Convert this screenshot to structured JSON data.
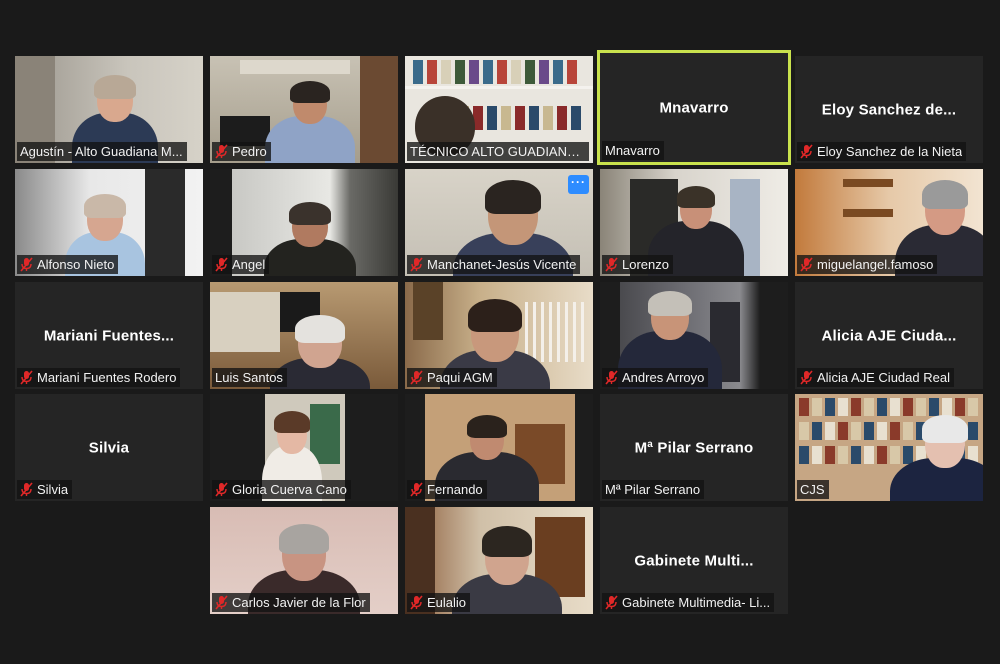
{
  "app": "Zoom gallery view",
  "colors": {
    "background": "#1a1a1a",
    "tile": "#252525",
    "active_speaker_border": "#c9e24d",
    "muted_icon": "#e02828",
    "more_button": "#2d8cff"
  },
  "participants": [
    {
      "name": "Agustín - Alto Guadiana M...",
      "muted": false,
      "video": true,
      "scene": "office-bright"
    },
    {
      "name": "Pedro",
      "muted": true,
      "video": true,
      "scene": "office-shelf"
    },
    {
      "name": "TÉCNICO ALTO GUADIANA ...",
      "muted": false,
      "video": true,
      "scene": "bookshelf"
    },
    {
      "name": "Mnavarro",
      "center_label": "Mnavarro",
      "muted": false,
      "video": false,
      "active_speaker": true
    },
    {
      "name": "Eloy Sanchez de la Nieta",
      "center_label": "Eloy Sanchez de...",
      "muted": true,
      "video": false
    },
    {
      "name": "Alfonso Nieto",
      "muted": true,
      "video": true,
      "scene": "white-room"
    },
    {
      "name": "Angel",
      "muted": true,
      "video": true,
      "scene": "dark-window"
    },
    {
      "name": "Manchanet-Jesús Vicente",
      "muted": true,
      "video": true,
      "scene": "plain-wall",
      "more_icon": "ellipsis-icon",
      "more_label": "···"
    },
    {
      "name": "Lorenzo",
      "muted": true,
      "video": true,
      "scene": "office-window"
    },
    {
      "name": "miguelangel.famoso",
      "muted": true,
      "video": true,
      "scene": "wood-shelf"
    },
    {
      "name": "Mariani Fuentes Rodero",
      "center_label": "Mariani  Fuentes...",
      "muted": true,
      "video": false
    },
    {
      "name": "Luis Santos",
      "muted": false,
      "video": true,
      "scene": "kitchen"
    },
    {
      "name": "Paqui AGM",
      "muted": true,
      "video": true,
      "scene": "stairs"
    },
    {
      "name": "Andres Arroyo",
      "muted": true,
      "video": true,
      "scene": "dark-office"
    },
    {
      "name": "Alicia AJE Ciudad Real",
      "center_label": "Alicia  AJE  Ciuda...",
      "muted": true,
      "video": false
    },
    {
      "name": "Silvia",
      "center_label": "Silvia",
      "muted": true,
      "video": false
    },
    {
      "name": "Gloria Cuerva Cano",
      "muted": true,
      "video": true,
      "scene": "pillarbox-shelf"
    },
    {
      "name": "Fernando",
      "muted": true,
      "video": true,
      "scene": "pillarbox-room"
    },
    {
      "name": "Mª Pilar Serrano",
      "center_label": "Mª Pilar Serrano",
      "muted": false,
      "video": false
    },
    {
      "name": "CJS",
      "muted": false,
      "video": true,
      "scene": "library"
    },
    {
      "name": "Carlos Javier de la Flor",
      "muted": true,
      "video": true,
      "scene": "pink-wall"
    },
    {
      "name": "Eulalio",
      "muted": true,
      "video": true,
      "scene": "living-room"
    },
    {
      "name": "Gabinete Multimedia- Li...",
      "center_label": "Gabinete  Multi...",
      "muted": true,
      "video": false
    }
  ]
}
